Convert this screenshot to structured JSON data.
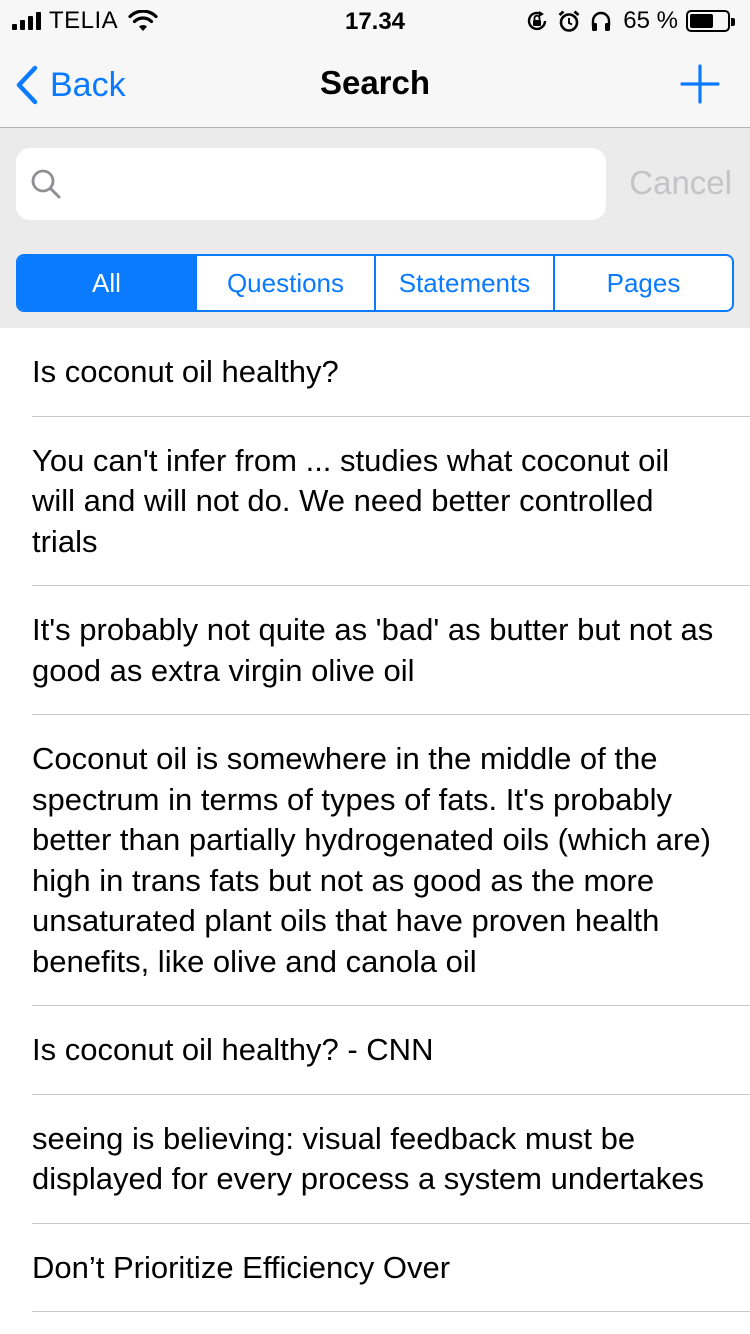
{
  "status_bar": {
    "carrier": "TELIA",
    "time": "17.34",
    "battery_percent": "65 %",
    "battery_level": 0.65
  },
  "nav": {
    "back_label": "Back",
    "title": "Search"
  },
  "search": {
    "placeholder": "",
    "value": "",
    "cancel_label": "Cancel"
  },
  "segments": [
    {
      "label": "All",
      "selected": true
    },
    {
      "label": "Questions",
      "selected": false
    },
    {
      "label": "Statements",
      "selected": false
    },
    {
      "label": "Pages",
      "selected": false
    }
  ],
  "results": [
    "Is coconut oil healthy?",
    "You can't infer from ... studies what coconut oil will and will not do. We need better controlled trials",
    "It's probably not quite as 'bad' as butter but not as good as extra virgin olive oil",
    "Coconut oil is somewhere in the middle of the spectrum in terms of types of fats. It's probably better than partially hydrogenated oils (which are) high in trans fats but not as good as the more unsaturated plant oils that have proven health benefits, like olive and canola oil",
    "Is coconut oil healthy? - CNN",
    "seeing is believing: visual feedback must be displayed for every process a system undertakes",
    "Don’t Prioritize Efficiency Over"
  ],
  "colors": {
    "accent": "#0a7aff",
    "bar_background": "#f7f7f7",
    "search_background": "#ebebeb",
    "separator": "#c8c7cc",
    "cancel": "#c4c4c6"
  }
}
